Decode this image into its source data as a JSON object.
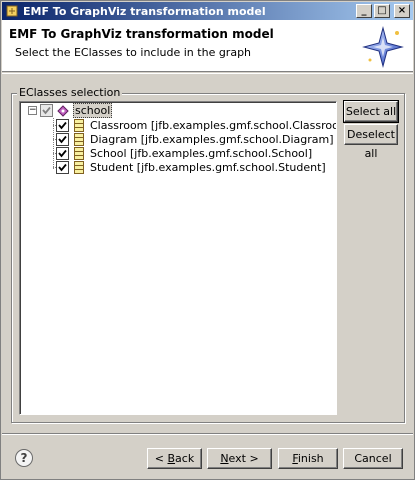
{
  "window": {
    "title": "EMF To GraphViz transformation model",
    "icon": "wizard-icon",
    "controls": {
      "minimize": "_",
      "maximize": "□",
      "close": "×"
    }
  },
  "header": {
    "title": "EMF To GraphViz transformation model",
    "description": "Select the EClasses to include in the graph",
    "image": "sparkle-wizard-icon"
  },
  "group": {
    "label": "EClasses selection"
  },
  "tree": {
    "root": {
      "label": "school",
      "expander": "−",
      "checked": true,
      "grayed": true,
      "icon": "package-icon"
    },
    "children": [
      {
        "label": "Classroom [jfb.examples.gmf.school.Classroom]",
        "checked": true,
        "icon": "eclass-icon"
      },
      {
        "label": "Diagram [jfb.examples.gmf.school.Diagram]",
        "checked": true,
        "icon": "eclass-icon"
      },
      {
        "label": "School [jfb.examples.gmf.school.School]",
        "checked": true,
        "icon": "eclass-icon"
      },
      {
        "label": "Student [jfb.examples.gmf.school.Student]",
        "checked": true,
        "icon": "eclass-icon"
      }
    ]
  },
  "side_buttons": {
    "select_all": "Select all",
    "deselect_all": "Deselect all"
  },
  "footer": {
    "help": "?",
    "back": "< Back",
    "back_pre": "< ",
    "back_mn": "B",
    "back_post": "ack",
    "next_mn": "N",
    "next_post": "ext >",
    "finish_mn": "F",
    "finish_post": "inish",
    "cancel": "Cancel"
  }
}
